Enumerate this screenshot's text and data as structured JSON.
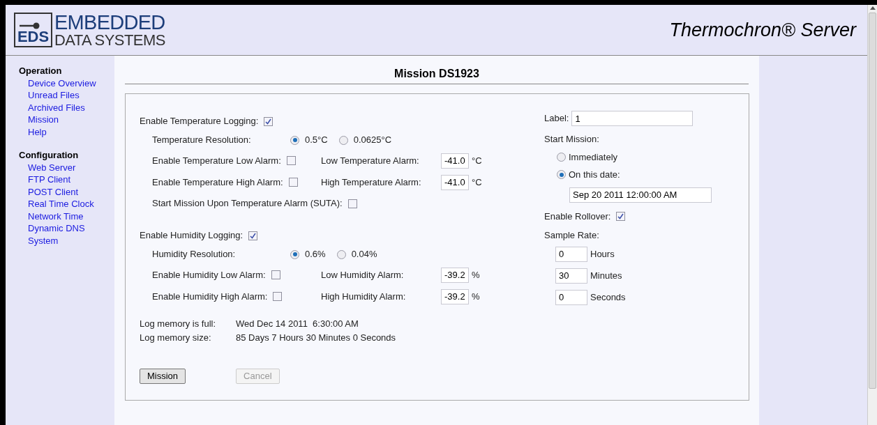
{
  "header": {
    "logo": {
      "mark": "EDS",
      "line1": "EMBEDDED",
      "line2": "DATA SYSTEMS"
    },
    "title": "Thermochron® Server"
  },
  "sidebar": [
    {
      "heading": "Operation",
      "items": [
        {
          "label": "Device Overview"
        },
        {
          "label": "Unread Files"
        },
        {
          "label": "Archived Files"
        },
        {
          "label": "Mission"
        },
        {
          "label": "Help"
        }
      ]
    },
    {
      "heading": "Configuration",
      "items": [
        {
          "label": "Web Server"
        },
        {
          "label": "FTP Client"
        },
        {
          "label": "POST Client"
        },
        {
          "label": "Real Time Clock"
        },
        {
          "label": "Network Time"
        },
        {
          "label": "Dynamic DNS"
        },
        {
          "label": "System"
        }
      ]
    }
  ],
  "main": {
    "title": "Mission DS1923",
    "sections": [
      {
        "enable": {
          "label": "Enable Temperature Logging:",
          "checked": true
        },
        "resolution": {
          "label": "Temperature Resolution:",
          "options": [
            {
              "label": "0.5°C",
              "selected": true
            },
            {
              "label": "0.0625°C",
              "selected": false
            }
          ]
        },
        "alarms": [
          {
            "enable_label": "Enable Temperature Low Alarm:",
            "checked": false,
            "value_label": "Low Temperature Alarm:",
            "value": "-41.0",
            "unit": "°C"
          },
          {
            "enable_label": "Enable Temperature High Alarm:",
            "checked": false,
            "value_label": "High Temperature Alarm:",
            "value": "-41.0",
            "unit": "°C"
          }
        ],
        "suta": {
          "label": "Start Mission Upon Temperature Alarm (SUTA):",
          "checked": false
        }
      },
      {
        "enable": {
          "label": "Enable Humidity Logging:",
          "checked": true
        },
        "resolution": {
          "label": "Humidity Resolution:",
          "options": [
            {
              "label": "0.6%",
              "selected": true
            },
            {
              "label": "0.04%",
              "selected": false
            }
          ]
        },
        "alarms": [
          {
            "enable_label": "Enable Humidity Low Alarm:",
            "checked": false,
            "value_label": "Low Humidity Alarm:",
            "value": "-39.2",
            "unit": "%"
          },
          {
            "enable_label": "Enable Humidity High Alarm:",
            "checked": false,
            "value_label": "High Humidity Alarm:",
            "value": "-39.2",
            "unit": "%"
          }
        ]
      }
    ],
    "log_info": [
      {
        "label": "Log memory is full:",
        "value": "Wed Dec 14 2011  6:30:00 AM"
      },
      {
        "label": "Log memory size:",
        "value": "85 Days 7 Hours 30 Minutes 0 Seconds"
      }
    ],
    "buttons": [
      {
        "label": "Mission",
        "disabled": false
      },
      {
        "label": "Cancel",
        "disabled": true
      }
    ],
    "label_field": {
      "label": "Label:",
      "value": "1"
    },
    "start_mission": {
      "label": "Start Mission:",
      "options": [
        {
          "label": "Immediately",
          "selected": false
        },
        {
          "label": "On this date:",
          "selected": true
        }
      ],
      "date_value": "Sep 20 2011 12:00:00 AM"
    },
    "rollover": {
      "label": "Enable Rollover:",
      "checked": true
    },
    "sample_rate": {
      "label": "Sample Rate:",
      "fields": [
        {
          "value": "0",
          "unit": "Hours"
        },
        {
          "value": "30",
          "unit": "Minutes"
        },
        {
          "value": "0",
          "unit": "Seconds"
        }
      ]
    }
  }
}
